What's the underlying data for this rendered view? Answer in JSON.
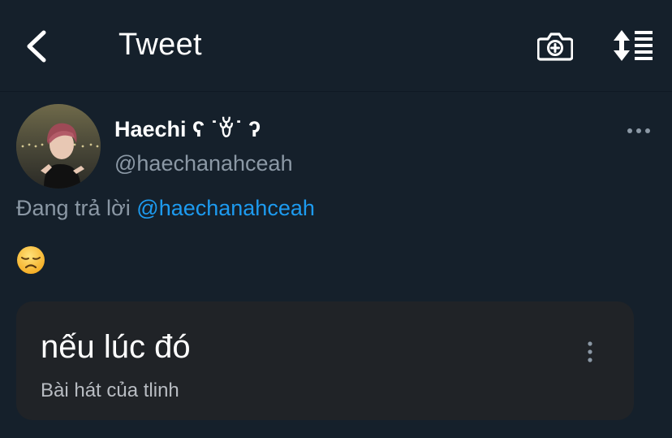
{
  "header": {
    "title": "Tweet",
    "back_icon": "chevron-left-icon",
    "camera_icon": "camera-plus-icon",
    "sort_icon": "sort-icon"
  },
  "tweet": {
    "author_name": "Haechi ʕ ˙ꈊ˙ ʔ",
    "author_handle": "@haechanahceah",
    "reply_prefix": "Đang trả lời",
    "reply_mention": "@haechanahceah",
    "content_emoji": "disappointed-face-emoji"
  },
  "card": {
    "title": "nếu lúc đó",
    "subtitle": "Bài hát của tlinh"
  },
  "colors": {
    "background": "#15202b",
    "mention": "#1d9bf0",
    "secondary_text": "#8b98a5",
    "card_bg": "#202327"
  }
}
